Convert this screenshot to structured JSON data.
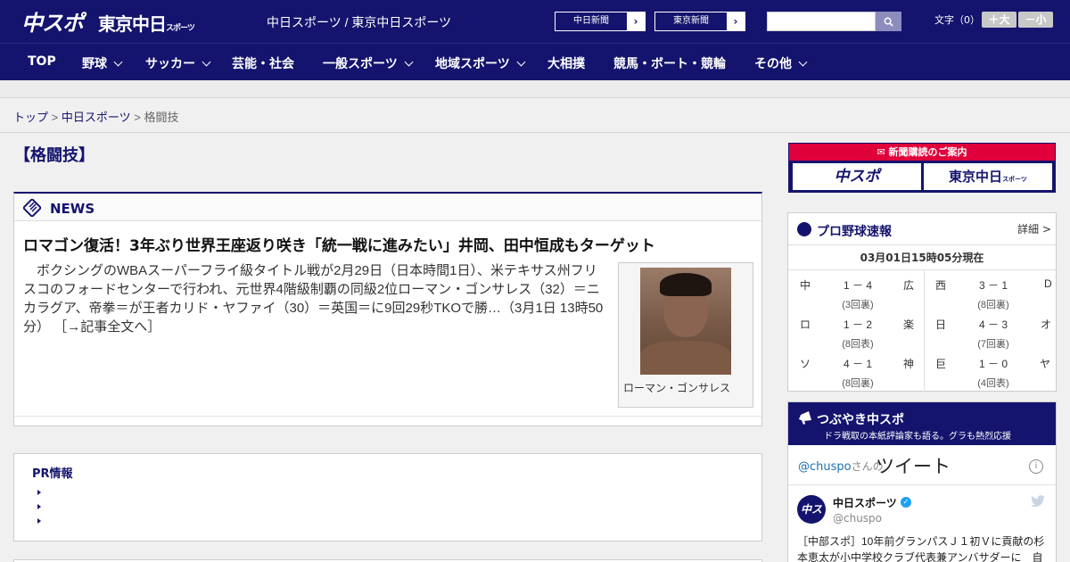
{
  "header": {
    "logo_main": "中スポ",
    "logo_tokyo": "東京中日",
    "logo_tokyo_small": "スポーツ",
    "site_title": "中日スポーツ / 東京中日スポーツ",
    "ext_links": [
      {
        "label": "中日新聞"
      },
      {
        "label": "東京新聞"
      }
    ],
    "search": {
      "placeholder": "",
      "value": ""
    },
    "fontsize_label": "文字（0）",
    "font_up": "＋大",
    "font_down": "－小"
  },
  "nav": {
    "items": [
      {
        "label": "TOP",
        "dropdown": false
      },
      {
        "label": "野球",
        "dropdown": true
      },
      {
        "label": "サッカー",
        "dropdown": true
      },
      {
        "label": "芸能・社会",
        "dropdown": false
      },
      {
        "label": "一般スポーツ",
        "dropdown": true
      },
      {
        "label": "地域スポーツ",
        "dropdown": true
      },
      {
        "label": "大相撲",
        "dropdown": false
      },
      {
        "label": "競馬・ボート・競輪",
        "dropdown": false
      },
      {
        "label": "その他",
        "dropdown": true
      }
    ]
  },
  "breadcrumb": {
    "items": [
      "トップ",
      "中日スポーツ",
      "格闘技"
    ],
    "separator": ">"
  },
  "category_title": "【格闘技】",
  "news": {
    "section_label": "NEWS",
    "headline": "ロマゴン復活！3年ぶり世界王座返り咲き「統一戦に進みたい」井岡、田中恒成もターゲット",
    "lead": "　ボクシングのWBAスーパーフライ級タイトル戦が2月29日（日本時間1日）、米テキサス州フリスコのフォードセンターで行われ、元世界4階級制覇の同級2位ローマン・ゴンサレス（32）＝ニカラグア、帝拳＝が王者カリド・ヤファイ（30）＝英国＝に9回29秒TKOで勝…（3月1日 13時50分）",
    "more_link": "［→記事全文へ］",
    "photo_caption": "ローマン・ゴンサレス"
  },
  "pr": {
    "title": "PR情報",
    "items": [
      "",
      "",
      ""
    ]
  },
  "subscription": {
    "label": "新聞購読のご案内",
    "logo_left": "中スポ",
    "logo_right": "東京中日",
    "logo_right_small": "スポーツ"
  },
  "baseball": {
    "title": "プロ野球速報",
    "detail_link": "詳細 >",
    "timestamp": "03月01日15時05分現在",
    "games": [
      {
        "home": "中",
        "score": "1 － 4",
        "away": "広",
        "inning": "(3回裏)"
      },
      {
        "home": "西",
        "score": "3 － 1",
        "away": "D",
        "inning": "(8回裏)"
      },
      {
        "home": "ロ",
        "score": "1 － 2",
        "away": "楽",
        "inning": "(8回表)"
      },
      {
        "home": "日",
        "score": "4 － 3",
        "away": "オ",
        "inning": "(7回裏)"
      },
      {
        "home": "ソ",
        "score": "4 － 1",
        "away": "神",
        "inning": "(8回裏)"
      },
      {
        "home": "巨",
        "score": "1 － 0",
        "away": "ヤ",
        "inning": "(4回表)"
      }
    ]
  },
  "twitter": {
    "title": "つぶやき中スポ",
    "subtitle": "ドラ戦取の本紙評論家も語る。グラも熱烈応援",
    "handle": "@chuspo",
    "handle_suffix": "さんの",
    "heading": "ツイート",
    "account_name": "中日スポーツ",
    "account_handle": "@chuspo",
    "avatar_text": "中スポ",
    "tweet_text": "［中部スポ］10年前グランパスＪ１初Ｖに貢献の杉本恵太が小中学校クラブ代表兼アンバサダーに　自"
  },
  "colors": {
    "brand_navy": "#14146e",
    "accent_red": "#e0003c",
    "twitter_blue": "#1da1f2"
  }
}
